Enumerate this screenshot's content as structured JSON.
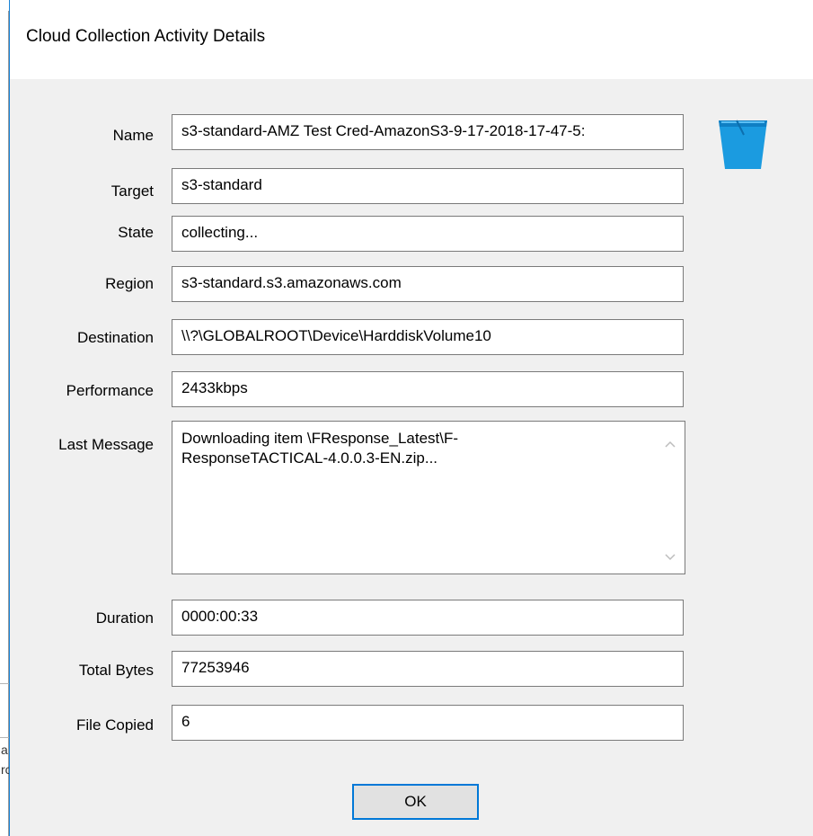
{
  "dialog": {
    "title": "Cloud Collection Activity Details",
    "bucket_icon": "bucket-icon",
    "accent_color": "#0078d7",
    "bucket_color": "#1b9be0"
  },
  "fields": {
    "name": {
      "label": "Name",
      "value": "s3-standard-AMZ Test Cred-AmazonS3-9-17-2018-17-47-5:"
    },
    "target": {
      "label": "Target",
      "value": "s3-standard"
    },
    "state": {
      "label": "State",
      "value": "collecting..."
    },
    "region": {
      "label": "Region",
      "value": "s3-standard.s3.amazonaws.com"
    },
    "destination": {
      "label": "Destination",
      "value": "\\\\?\\GLOBALROOT\\Device\\HarddiskVolume10"
    },
    "performance": {
      "label": "Performance",
      "value": "2433kbps"
    },
    "last_message": {
      "label": "Last Message",
      "line1": "Downloading item \\FResponse_Latest\\F-",
      "line2": "ResponseTACTICAL-4.0.0.3-EN.zip..."
    },
    "duration": {
      "label": "Duration",
      "value": "0000:00:33"
    },
    "total_bytes": {
      "label": "Total Bytes",
      "value": "77253946"
    },
    "file_copied": {
      "label": "File Copied",
      "value": "6"
    }
  },
  "buttons": {
    "ok": "OK"
  },
  "background": {
    "left_chars": [
      "a",
      "rc"
    ]
  }
}
